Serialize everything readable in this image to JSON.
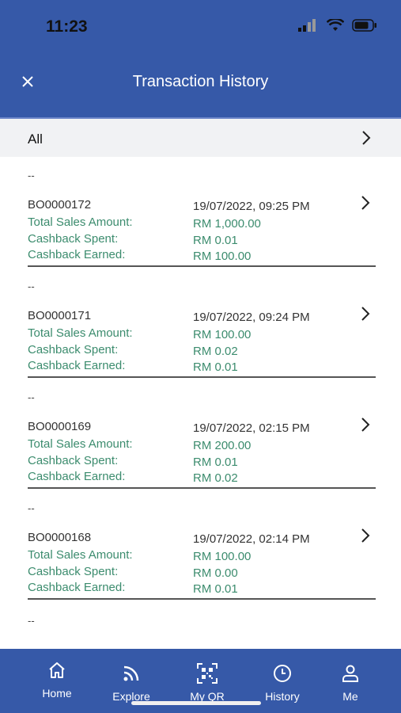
{
  "status_bar": {
    "time": "11:23"
  },
  "header": {
    "title": "Transaction History"
  },
  "filter": {
    "label": "All"
  },
  "field_labels": {
    "sales": "Total Sales Amount:",
    "spent": "Cashback Spent:",
    "earned": "Cashback Earned:"
  },
  "transactions": [
    {
      "dash": "--",
      "id": "BO0000172",
      "datetime": "19/07/2022, 09:25 PM",
      "sales": "RM 1,000.00",
      "spent": "RM 0.01",
      "earned": "RM 100.00"
    },
    {
      "dash": "--",
      "id": "BO0000171",
      "datetime": "19/07/2022, 09:24 PM",
      "sales": "RM 100.00",
      "spent": "RM 0.02",
      "earned": "RM 0.01"
    },
    {
      "dash": "--",
      "id": "BO0000169",
      "datetime": "19/07/2022, 02:15 PM",
      "sales": "RM 200.00",
      "spent": "RM 0.01",
      "earned": "RM 0.02"
    },
    {
      "dash": "--",
      "id": "BO0000168",
      "datetime": "19/07/2022, 02:14 PM",
      "sales": "RM 100.00",
      "spent": "RM 0.00",
      "earned": "RM 0.01"
    }
  ],
  "partial_entry": {
    "dash": "--"
  },
  "nav": {
    "home": "Home",
    "explore": "Explore",
    "myqr": "My QR",
    "history": "History",
    "me": "Me"
  },
  "colors": {
    "primary": "#3659a8",
    "value_green": "#3c8c6e"
  }
}
